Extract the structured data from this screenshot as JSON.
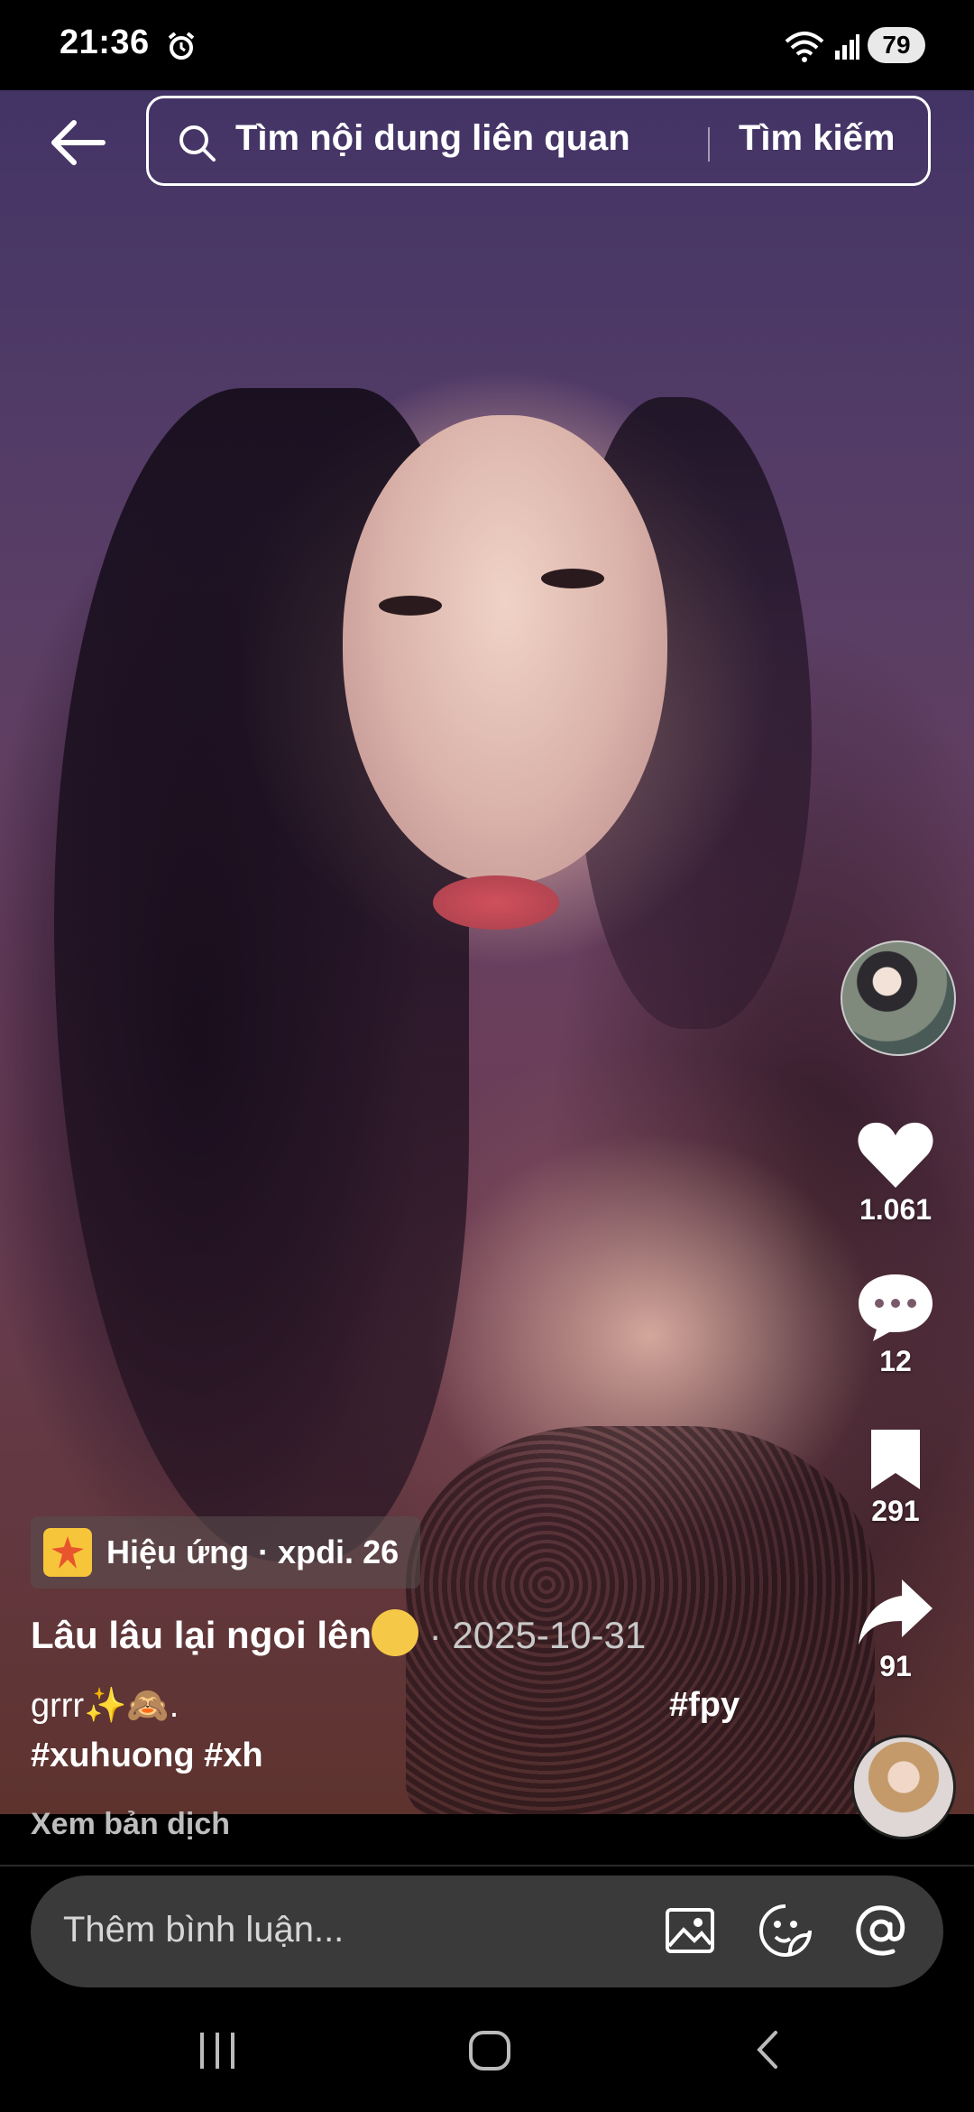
{
  "status": {
    "time": "21:36",
    "battery": "79"
  },
  "search": {
    "placeholder": "Tìm nội dung liên quan",
    "button": "Tìm kiếm"
  },
  "actions": {
    "likes": "1.061",
    "comments": "12",
    "saves": "291",
    "shares": "91"
  },
  "effect": {
    "label": "Hiệu ứng · xpdi. 26"
  },
  "caption": {
    "title": "Lâu lâu lại ngoi lên",
    "date": "· 2025-10-31",
    "line1": "grrr✨🙈.",
    "hashtag_fpy": "#fpy",
    "line2": "#xuhuong #xh"
  },
  "translate": "Xem bản dịch",
  "comment": {
    "placeholder": "Thêm bình luận..."
  },
  "icons": [
    "alarm-icon",
    "wifi-icon",
    "signal-icon",
    "back-arrow-icon",
    "search-icon",
    "heart-icon",
    "comment-icon",
    "bookmark-icon",
    "share-icon",
    "image-icon",
    "sticker-icon",
    "mention-icon",
    "recents-icon",
    "home-icon",
    "back-icon"
  ]
}
